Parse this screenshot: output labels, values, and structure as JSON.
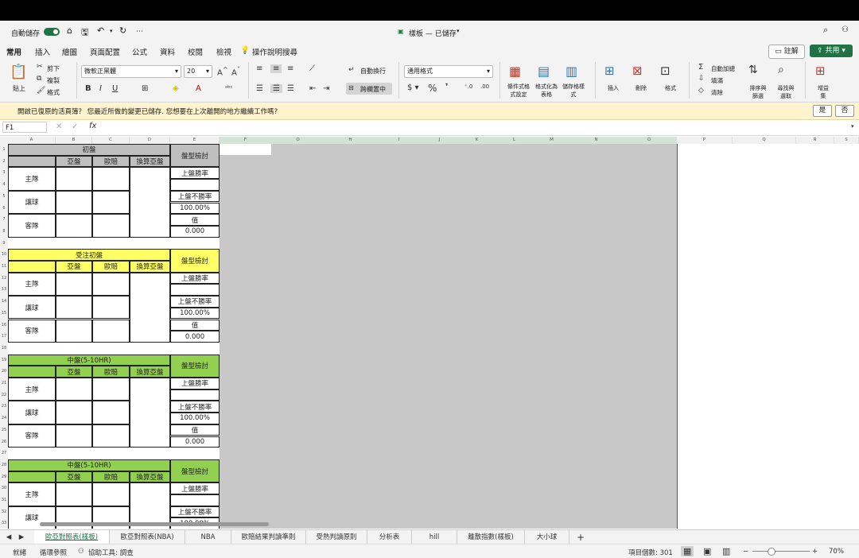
{
  "titlebar": {
    "autosave": "自動儲存",
    "doc_title": "樣板 — 已儲存",
    "more": "⋯"
  },
  "tabs": [
    "常用",
    "插入",
    "繪圖",
    "頁面配置",
    "公式",
    "資料",
    "校閱",
    "檢視"
  ],
  "tell_me": "操作說明搜尋",
  "comment_label": "註解",
  "share_label": "共用",
  "ribbon": {
    "paste": "貼上",
    "cut": "剪下",
    "copy": "複製",
    "format_painter": "格式",
    "font_name": "微軟正黑體",
    "font_size": "20",
    "wrap_text": "自動換行",
    "merge_center": "跨欄置中",
    "number_format": "通用格式",
    "cond_format": "條件式格式設定",
    "format_table": "格式化為表格",
    "cell_styles": "儲存格樣式",
    "insert": "插入",
    "delete": "刪除",
    "format": "格式",
    "autosum": "自動加總",
    "fill": "填滿",
    "clear": "清除",
    "sort_filter": "排序與篩選",
    "find_select": "尋找與選取",
    "addins": "增益集"
  },
  "message": {
    "text": "開啟已復原的活頁簿？ 您最近所做的變更已儲存. 您想要在上次離開的地方繼續工作嗎?",
    "yes": "是",
    "no": "否"
  },
  "formula_bar": {
    "name_box": "F1",
    "fx": "fx"
  },
  "columns": [
    "A",
    "B",
    "C",
    "D",
    "E",
    "F",
    "O",
    "H",
    "I",
    "J",
    "K",
    "L",
    "M",
    "N",
    "O",
    "P",
    "Q",
    "R",
    "S"
  ],
  "rows": [
    "1",
    "2",
    "3",
    "4",
    "5",
    "6",
    "7",
    "8",
    "9",
    "10",
    "11",
    "12",
    "13",
    "14",
    "15",
    "16",
    "17",
    "18",
    "19",
    "20",
    "21",
    "22",
    "23",
    "24",
    "25",
    "26",
    "27",
    "28",
    "29",
    "30",
    "31",
    "32",
    "33"
  ],
  "blocks": [
    {
      "title": "初盤",
      "color": "#bfbfbf",
      "sub": [
        "亞盤",
        "歐賠",
        "換算亞盤"
      ],
      "rows": [
        "主隊",
        "讓球",
        "客隊"
      ],
      "check": "盤型檢討",
      "win": "上盤勝率",
      "lose": "上盤不勝率",
      "pct": "100.00%",
      "val": "值",
      "num": "0.000"
    },
    {
      "title": "受注初盤",
      "color": "#ffff66",
      "sub": [
        "亞盤",
        "歐賠",
        "換算亞盤"
      ],
      "rows": [
        "主隊",
        "讓球",
        "客隊"
      ],
      "check": "盤型檢討",
      "win": "上盤勝率",
      "lose": "上盤不勝率",
      "pct": "100.00%",
      "val": "值",
      "num": "0.000"
    },
    {
      "title": "中盤(5-10HR)",
      "color": "#92d050",
      "sub": [
        "亞盤",
        "歐賠",
        "換算亞盤"
      ],
      "rows": [
        "主隊",
        "讓球",
        "客隊"
      ],
      "check": "盤型檢討",
      "win": "上盤勝率",
      "lose": "上盤不勝率",
      "pct": "100.00%",
      "val": "值",
      "num": "0.000"
    },
    {
      "title": "中盤(5-10HR)",
      "color": "#92d050",
      "sub": [
        "亞盤",
        "歐賠",
        "換算亞盤"
      ],
      "rows": [
        "主隊",
        "讓球"
      ],
      "check": "盤型檢討",
      "win": "上盤勝率",
      "lose": "上盤不勝率",
      "pct": "100.00%"
    }
  ],
  "sheets": [
    "歐亞對照表(樣板)",
    "歐亞對照表(NBA)",
    "NBA",
    "歐賠結果判讀準則",
    "受熱判讀原則",
    "分析表",
    "hill",
    "離散指數(樣板)",
    "大小球"
  ],
  "status": {
    "ready": "就緒",
    "circular": "循環參照",
    "accessibility": "協助工具: 調查",
    "count": "項目個數: 301",
    "zoom": "70%"
  }
}
